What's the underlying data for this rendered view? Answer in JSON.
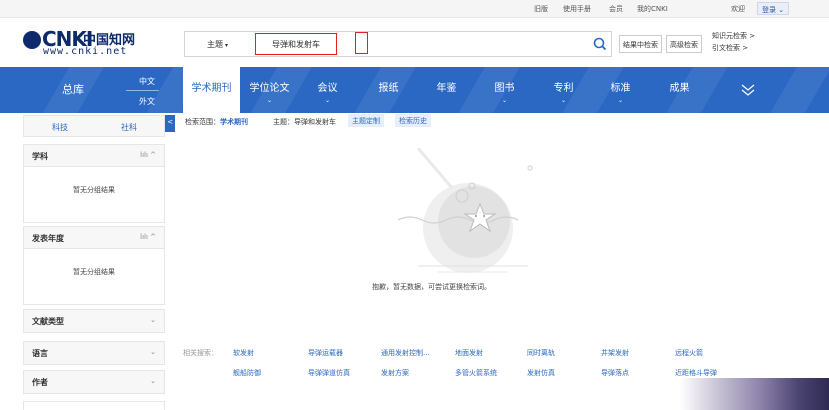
{
  "topbar": {
    "links": [
      "旧版",
      "使用手册",
      "会员",
      "我的CNKI",
      "欢迎"
    ],
    "login_label": "登录",
    "login_arrow": "⌄"
  },
  "logo": {
    "brand": "CNKI",
    "cn": "中国知网",
    "url": "www.cnki.net"
  },
  "search": {
    "field_label": "主题",
    "field_arrow": "▾",
    "query_value": "导弹和发射车",
    "button_icon": "search-icon",
    "btn_result": "结果中检索",
    "btn_advanced": "高级检索",
    "link_knowledge": "知识元检索 >",
    "link_citation": "引文检索 >"
  },
  "nav": {
    "zongku": "总库",
    "zhongwen": "中文",
    "waiwen": "外文",
    "tabs": [
      {
        "label": "学术期刊",
        "dropdown": ""
      },
      {
        "label": "学位论文",
        "dropdown": "⌄"
      },
      {
        "label": "会议",
        "dropdown": "⌄"
      },
      {
        "label": "报纸",
        "dropdown": ""
      },
      {
        "label": "年鉴",
        "dropdown": ""
      },
      {
        "label": "图书",
        "dropdown": "⌄"
      },
      {
        "label": "专利",
        "dropdown": "⌄"
      },
      {
        "label": "标准",
        "dropdown": "⌄"
      },
      {
        "label": "成果",
        "dropdown": ""
      }
    ],
    "more_icon": "double-chevron-down-icon"
  },
  "left": {
    "tab_science": "科技",
    "tab_social": "社科",
    "collapse": "<",
    "panels": [
      {
        "title": "学科",
        "icon": "lılı ^",
        "body": "暂无分组结果"
      },
      {
        "title": "发表年度",
        "icon": "lılı ^",
        "body": "暂无分组结果"
      }
    ],
    "collapsed": [
      {
        "title": "文献类型",
        "icon": "⌄"
      },
      {
        "title": "语言",
        "icon": "⌄"
      },
      {
        "title": "作者",
        "icon": "⌄"
      }
    ]
  },
  "scope": {
    "label": "检索范围：",
    "value": "学术期刊",
    "query": "主题：导弹和发射车",
    "chip_custom": "主题定制",
    "chip_history": "检索历史"
  },
  "empty": {
    "message": "抱歉，暂无数据，可尝试更换检索词。"
  },
  "related": {
    "label": "相关搜索：",
    "row1": [
      "软发射",
      "导弹运载器",
      "通用发射控制...",
      "地面发射",
      "同时离轨",
      "井架发射",
      "远程火箭"
    ],
    "row2": [
      "舰船防御",
      "导弹弹道仿真",
      "发射方案",
      "多管火箭系统",
      "发射仿真",
      "导弹落点",
      "近距格斗导弹"
    ]
  },
  "colors": {
    "accent": "#2a68c4",
    "highlight": "#e02020"
  }
}
